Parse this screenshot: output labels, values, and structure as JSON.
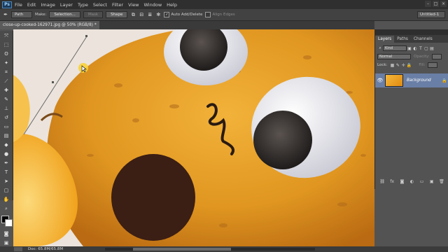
{
  "menubar": {
    "logo": "Ps",
    "items": [
      "File",
      "Edit",
      "Image",
      "Layer",
      "Type",
      "Select",
      "Filter",
      "View",
      "Window",
      "Help"
    ],
    "window_controls": [
      "–",
      "□",
      "×"
    ]
  },
  "options": {
    "path_mode": "Path",
    "make_label": "Make:",
    "selection_btn": "Selection...",
    "mask_btn": "Mask",
    "shape_btn": "Shape",
    "auto_add_delete": "Auto Add/Delete",
    "align_edges": "Align Edges",
    "workspace": "Untitled-1"
  },
  "document": {
    "tab_title": "close-up-cooked-162971.jpg @ 50% (RGB/8) *"
  },
  "status": {
    "doc_size": "Doc: 65.8M/65.8M"
  },
  "layers_panel": {
    "tabs": [
      "Layers",
      "Paths",
      "Channels"
    ],
    "kind_label": "Kind",
    "blend_mode": "Normal",
    "opacity_label": "Opacity:",
    "lock_label": "Lock:",
    "fill_label": "Fill:",
    "layer_name": "Background"
  },
  "colors": {
    "menubar_bg": "#2f2f2f",
    "panel_bg": "#535353",
    "selected_layer": "#6a7fa6",
    "pumpkin": "#e39b1e"
  }
}
